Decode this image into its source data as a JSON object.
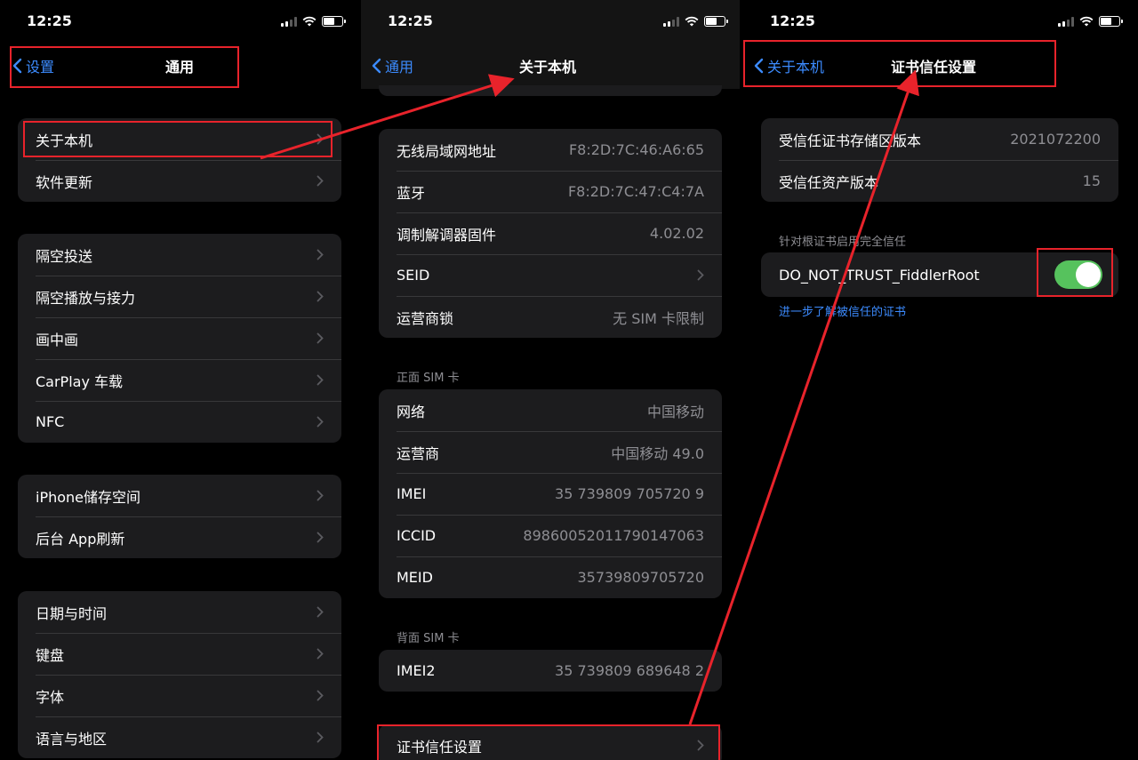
{
  "panel1": {
    "time": "12:25",
    "back_label": "设置",
    "title": "通用",
    "groups": [
      [
        {
          "label": "关于本机"
        },
        {
          "label": "软件更新"
        }
      ],
      [
        {
          "label": "隔空投送"
        },
        {
          "label": "隔空播放与接力"
        },
        {
          "label": "画中画"
        },
        {
          "label": "CarPlay 车载"
        },
        {
          "label": "NFC"
        }
      ],
      [
        {
          "label": "iPhone储存空间"
        },
        {
          "label": "后台 App刷新"
        }
      ],
      [
        {
          "label": "日期与时间"
        },
        {
          "label": "键盘"
        },
        {
          "label": "字体"
        },
        {
          "label": "语言与地区"
        }
      ]
    ]
  },
  "panel2": {
    "time": "12:25",
    "back_label": "通用",
    "title": "关于本机",
    "network_group": [
      {
        "label": "无线局域网地址",
        "value": "F8:2D:7C:46:A6:65"
      },
      {
        "label": "蓝牙",
        "value": "F8:2D:7C:47:C4:7A"
      },
      {
        "label": "调制解调器固件",
        "value": "4.02.02"
      },
      {
        "label": "SEID",
        "value": ""
      },
      {
        "label": "运营商锁",
        "value": "无 SIM 卡限制"
      }
    ],
    "front_sim_label": "正面 SIM 卡",
    "front_sim_group": [
      {
        "label": "网络",
        "value": "中国移动"
      },
      {
        "label": "运营商",
        "value": "中国移动 49.0"
      },
      {
        "label": "IMEI",
        "value": "35 739809 705720 9"
      },
      {
        "label": "ICCID",
        "value": "89860052011790147063"
      },
      {
        "label": "MEID",
        "value": "35739809705720"
      }
    ],
    "back_sim_label": "背面 SIM 卡",
    "back_sim_group": [
      {
        "label": "IMEI2",
        "value": "35 739809 689648 2"
      }
    ],
    "cert_trust_label": "证书信任设置"
  },
  "panel3": {
    "time": "12:25",
    "back_label": "关于本机",
    "title": "证书信任设置",
    "info_group": [
      {
        "label": "受信任证书存储区版本",
        "value": "2021072200"
      },
      {
        "label": "受信任资产版本",
        "value": "15"
      }
    ],
    "section_label": "针对根证书启用完全信任",
    "cert_name": "DO_NOT_TRUST_FiddlerRoot",
    "toggle_on": true,
    "learn_more": "进一步了解被信任的证书"
  },
  "colors": {
    "accent": "#3c8bfe",
    "toggle_on": "#56c25d",
    "annotation_red": "#e8232b",
    "cell_bg": "#1c1c1e"
  }
}
